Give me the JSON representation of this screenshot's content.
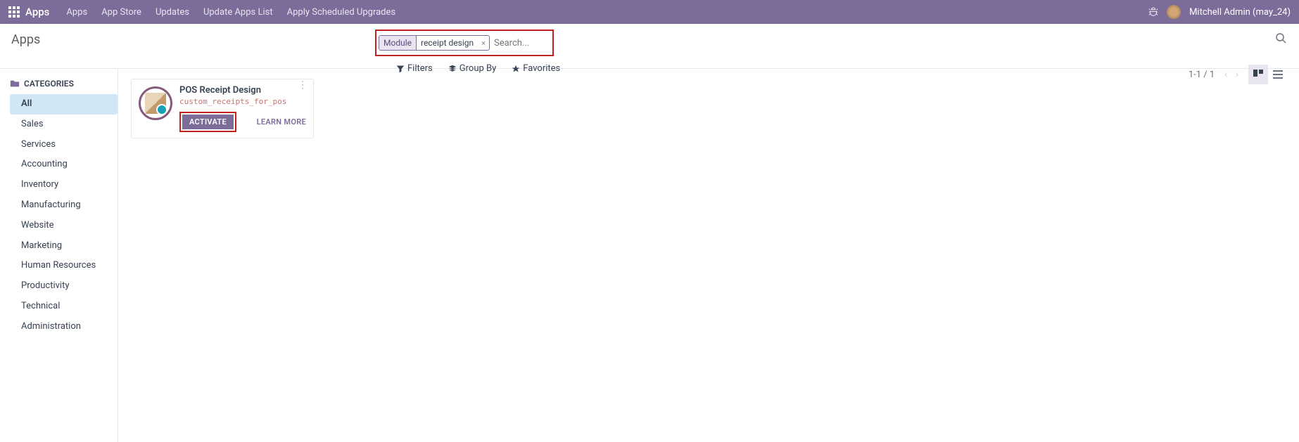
{
  "topbar": {
    "brand": "Apps",
    "nav": [
      "Apps",
      "App Store",
      "Updates",
      "Update Apps List",
      "Apply Scheduled Upgrades"
    ],
    "user": "Mitchell Admin (may_24)"
  },
  "breadcrumb": {
    "title": "Apps"
  },
  "search": {
    "filter_label": "Module",
    "filter_value": "receipt design",
    "placeholder": "Search..."
  },
  "tools": {
    "filters": "Filters",
    "groupby": "Group By",
    "favorites": "Favorites"
  },
  "pager": {
    "text": "1-1 / 1"
  },
  "sidebar": {
    "header": "CATEGORIES",
    "items": [
      "All",
      "Sales",
      "Services",
      "Accounting",
      "Inventory",
      "Manufacturing",
      "Website",
      "Marketing",
      "Human Resources",
      "Productivity",
      "Technical",
      "Administration"
    ],
    "active_index": 0
  },
  "card": {
    "name": "POS Receipt Design",
    "tech": "custom_receipts_for_pos",
    "activate": "ACTIVATE",
    "learn": "LEARN MORE"
  }
}
